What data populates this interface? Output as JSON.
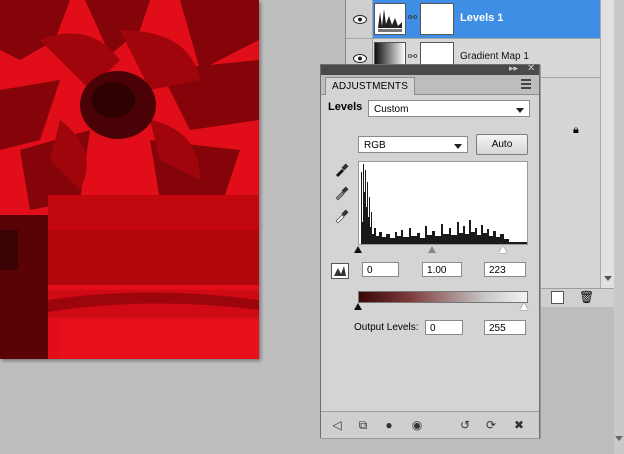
{
  "layers": [
    {
      "name": "Levels 1",
      "selected": true
    },
    {
      "name": "Gradient Map 1",
      "selected": false
    }
  ],
  "adjustments": {
    "tab_title": "ADJUSTMENTS",
    "preset_label": "Levels",
    "preset_value": "Custom",
    "channel_value": "RGB",
    "auto_label": "Auto",
    "input_levels": {
      "black": "0",
      "gamma": "1.00",
      "white": "223"
    },
    "output_levels_label": "Output Levels:",
    "output_levels": {
      "black": "0",
      "white": "255"
    }
  },
  "colors": {
    "canvas_red": "#e10d18",
    "selected_layer": "#3d8ee4",
    "panel_bg": "#d4d4d4"
  },
  "icons": {
    "eye": "eye-icon",
    "link": "link-icon",
    "black_eyedropper": "black-eyedropper-icon",
    "gray_eyedropper": "gray-eyedropper-icon",
    "white_eyedropper": "white-eyedropper-icon",
    "clip_warning": "clipping-warning-icon",
    "back": "back-arrow-icon",
    "expand": "expand-view-icon",
    "clip": "clip-to-layer-icon",
    "visibility": "visibility-icon",
    "previous_state": "previous-state-icon",
    "reset": "reset-icon",
    "trash": "trash-icon",
    "lock": "lock-icon",
    "new_layer": "new-layer-icon"
  }
}
